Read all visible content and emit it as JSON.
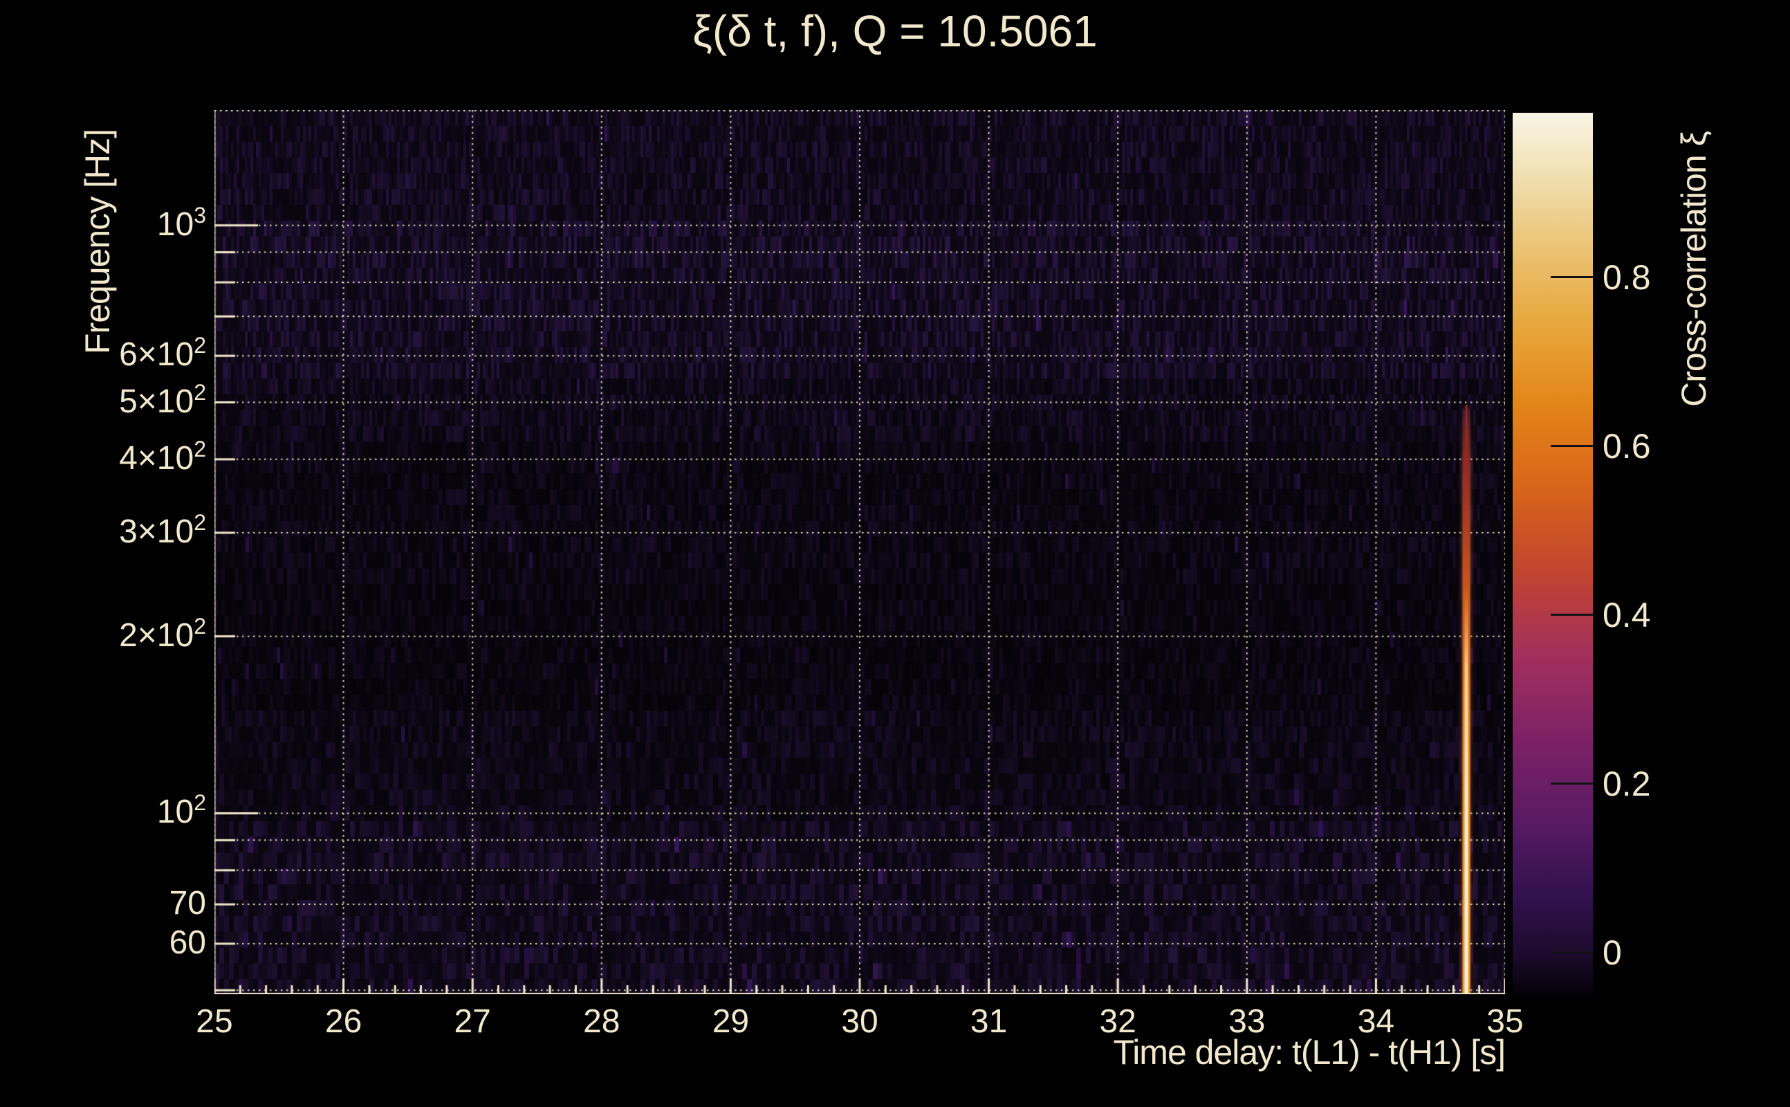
{
  "figure": {
    "title": "ξ(δ t, f), Q = 10.5061",
    "background_color": "#000000",
    "text_color": "#f2e9cd",
    "grid_color": "#f2e9cd"
  },
  "chart_data": {
    "type": "heatmap",
    "title": "ξ(δ t, f), Q = 10.5061",
    "xlabel": "Time delay: t(L1) - t(H1) [s]",
    "ylabel": "Frequency [Hz]",
    "x_range": [
      25,
      35
    ],
    "x_major_ticks": [
      25,
      26,
      27,
      28,
      29,
      30,
      31,
      32,
      33,
      34,
      35
    ],
    "x_tick_labels": [
      "25",
      "26",
      "27",
      "28",
      "29",
      "30",
      "31",
      "32",
      "33",
      "34",
      "35"
    ],
    "x_minor_tick_step": 0.2,
    "y_scale": "log",
    "y_range_hz": [
      49.1,
      1571
    ],
    "y_ticks": [
      {
        "f": 1000,
        "base": "10",
        "sup": "3",
        "major": true
      },
      {
        "f": 900
      },
      {
        "f": 800
      },
      {
        "f": 700
      },
      {
        "f": 600,
        "base": "6×10",
        "sup": "2"
      },
      {
        "f": 500,
        "base": "5×10",
        "sup": "2"
      },
      {
        "f": 400,
        "base": "4×10",
        "sup": "2"
      },
      {
        "f": 300,
        "base": "3×10",
        "sup": "2"
      },
      {
        "f": 200,
        "base": "2×10",
        "sup": "2"
      },
      {
        "f": 100,
        "base": "10",
        "sup": "2",
        "major": true
      },
      {
        "f": 90
      },
      {
        "f": 80
      },
      {
        "f": 70,
        "base": "70"
      },
      {
        "f": 60,
        "base": "60"
      },
      {
        "f": 50
      }
    ],
    "grid": {
      "style": "dotted",
      "x_lines": [
        25,
        26,
        27,
        28,
        29,
        30,
        31,
        32,
        33,
        34,
        35
      ]
    },
    "colorbar": {
      "label": "Cross-correlation ξ",
      "range": [
        -0.05,
        0.995
      ],
      "ticks": [
        0,
        0.2,
        0.4,
        0.6,
        0.8
      ],
      "tick_labels": [
        "0",
        "0.2",
        "0.4",
        "0.6",
        "0.8"
      ],
      "colormap": "inferno-like",
      "stops": [
        {
          "v": -0.05,
          "c": "#050208"
        },
        {
          "v": 0.0,
          "c": "#1d0b2f"
        },
        {
          "v": 0.07,
          "c": "#33114e"
        },
        {
          "v": 0.15,
          "c": "#571a63"
        },
        {
          "v": 0.25,
          "c": "#7c2166"
        },
        {
          "v": 0.35,
          "c": "#a12f5d"
        },
        {
          "v": 0.45,
          "c": "#c24430"
        },
        {
          "v": 0.55,
          "c": "#d9641b"
        },
        {
          "v": 0.65,
          "c": "#e38518"
        },
        {
          "v": 0.75,
          "c": "#e8a93f"
        },
        {
          "v": 0.85,
          "c": "#ecc87f"
        },
        {
          "v": 0.93,
          "c": "#f2e3b8"
        },
        {
          "v": 0.995,
          "c": "#f9f4e4"
        }
      ]
    },
    "signal": {
      "time_delay_s": 34.7,
      "freq_extent_hz": [
        49.1,
        490
      ],
      "peak_correlation": 0.99,
      "core_color": "#f7ecd2",
      "body_color": "#e8821f",
      "tip_color": "#96282a"
    },
    "background_texture": {
      "base_color_hsl": [
        266,
        50
      ],
      "description": "dark purple time-frequency tiles with faint vertical striations",
      "band_brightness": [
        {
          "f_hi": 1571,
          "f_lo": 1050,
          "mult": 1.15
        },
        {
          "f_hi": 1050,
          "f_lo": 850,
          "mult": 1.4
        },
        {
          "f_hi": 850,
          "f_lo": 560,
          "mult": 1.3
        },
        {
          "f_hi": 560,
          "f_lo": 430,
          "mult": 1.0
        },
        {
          "f_hi": 430,
          "f_lo": 240,
          "mult": 0.75
        },
        {
          "f_hi": 240,
          "f_lo": 150,
          "mult": 0.65
        },
        {
          "f_hi": 150,
          "f_lo": 95,
          "mult": 0.85
        },
        {
          "f_hi": 95,
          "f_lo": 49,
          "mult": 1.15
        }
      ]
    }
  }
}
